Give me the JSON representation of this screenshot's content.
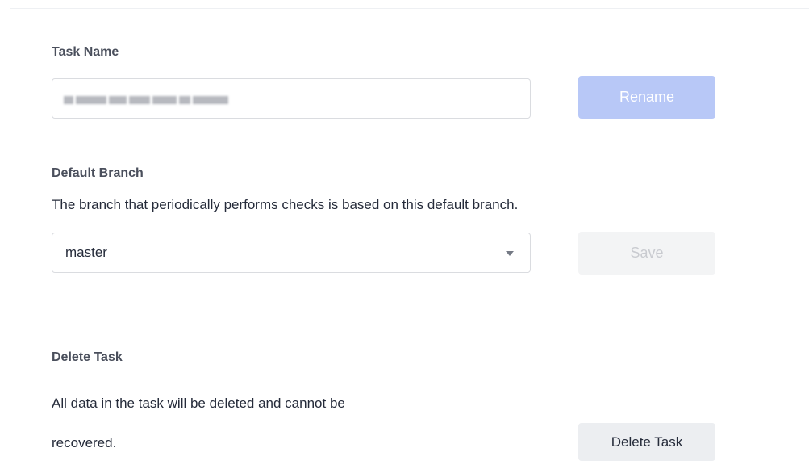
{
  "task_name_section": {
    "title": "Task Name",
    "input_value": "",
    "rename_label": "Rename"
  },
  "default_branch_section": {
    "title": "Default Branch",
    "description": "The branch that periodically performs checks is based on this default branch.",
    "selected_branch": "master",
    "save_label": "Save"
  },
  "delete_task_section": {
    "title": "Delete Task",
    "description_line1": "All data in the task will be deleted and cannot be",
    "description_line2": "recovered.",
    "delete_label": "Delete Task"
  },
  "colors": {
    "primary_disabled": "#b8c8f7",
    "secondary_disabled": "#f3f4f5",
    "danger_neutral": "#eceef1",
    "text": "#252b3a",
    "section_title": "#4a4f5c"
  },
  "icons": {
    "branch_select_caret": "caret-down-icon"
  }
}
